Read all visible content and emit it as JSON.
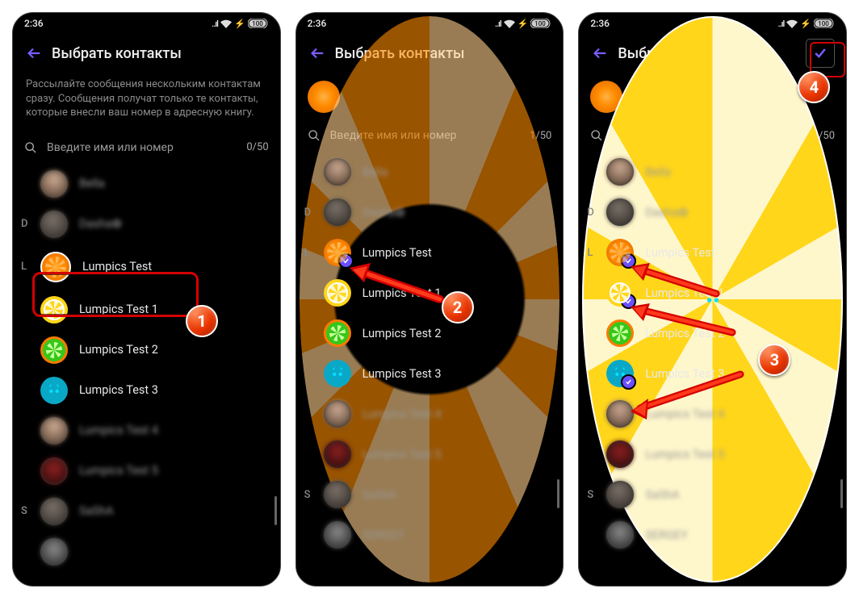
{
  "status": {
    "time": "2:36",
    "battery": "100"
  },
  "header": {
    "title": "Выбрать контакты"
  },
  "info_text": "Рассылайте сообщения нескольким контактам сразу. Сообщения получат только те контакты, которые внесли ваш номер в адресную книгу.",
  "search": {
    "placeholder": "Введите имя или номер",
    "max": "50"
  },
  "panels": [
    {
      "counter": "0/50"
    },
    {
      "counter": "1/50"
    },
    {
      "counter": "3/50"
    }
  ],
  "contacts": {
    "bella": "Bella",
    "dasha": "Dasha✿",
    "lumpics": "Lumpics Test",
    "lumpics1": "Lumpics Test 1",
    "lumpics2": "Lumpics Test 2",
    "lumpics3": "Lumpics Test 3",
    "lumpics4": "Lumpics Test 4",
    "lumpics5": "Lumpics Test 5",
    "sasha": "SaShA",
    "sergey": "SERGEY"
  },
  "callouts": {
    "c1": "1",
    "c2": "2",
    "c3": "3",
    "c4": "4"
  }
}
